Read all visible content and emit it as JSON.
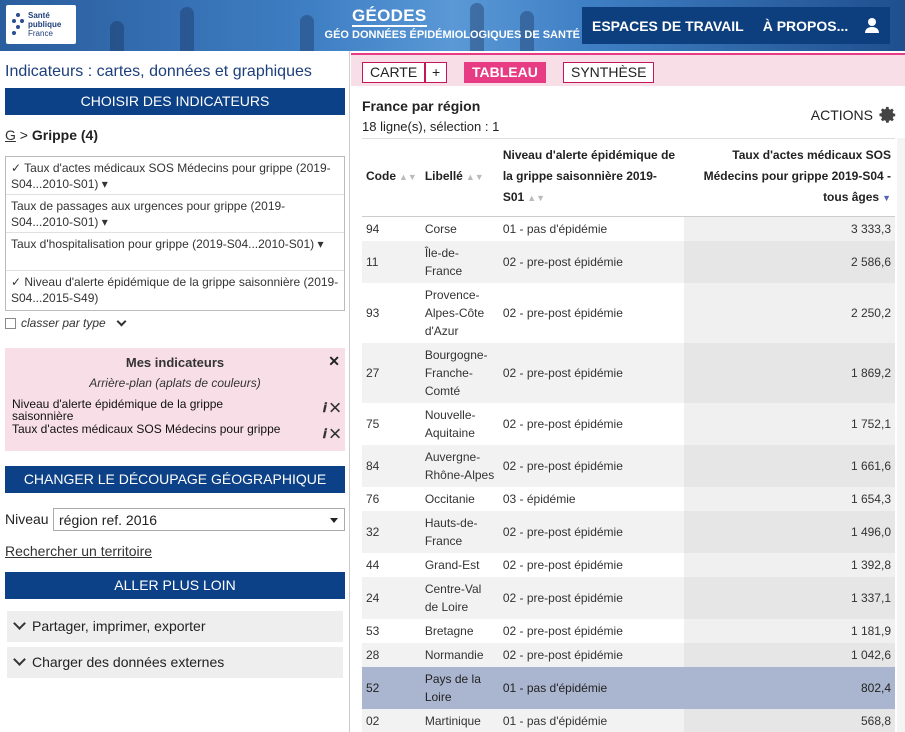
{
  "header": {
    "logo_line1": "Santé",
    "logo_line2": "publique",
    "logo_line3": "France",
    "title": "GÉODES",
    "subtitle": "GÉO DONNÉES ÉPIDÉMIOLOGIQUES DE SANTÉ",
    "nav_workspaces": "ESPACES DE TRAVAIL",
    "nav_about": "À PROPOS...",
    "user_icon": "user-icon"
  },
  "sidebar": {
    "title": "Indicateurs : cartes, données et graphiques",
    "choose_btn": "CHOISIR DES INDICATEURS",
    "crumb_root": "G",
    "crumb_sep": " > ",
    "crumb_current": "Grippe (4)",
    "indicators": [
      "✓ Taux d'actes médicaux SOS Médecins pour grippe (2019-S04...2010-S01) ▾",
      "Taux de passages aux urgences pour grippe (2019-S04...2010-S01) ▾",
      "Taux d'hospitalisation pour grippe (2019-S04...2010-S01) ▾",
      "✓ Niveau d'alerte épidémique de la grippe saisonnière (2019-S04...2015-S49)"
    ],
    "classer": "classer par type",
    "mine_title": "Mes indicateurs",
    "mine_background": "Arrière-plan (aplats de couleurs)",
    "mine_items": [
      "Niveau d'alerte épidémique de la grippe saisonnière",
      "Taux d'actes médicaux SOS Médecins pour grippe"
    ],
    "change_btn": "CHANGER LE DÉCOUPAGE GÉOGRAPHIQUE",
    "niveau_label": "Niveau",
    "niveau_value": "région ref. 2016",
    "search_link": "Rechercher un territoire",
    "further_btn": "ALLER PLUS LOIN",
    "acc_share": "Partager, imprimer, exporter",
    "acc_external": "Charger des données externes"
  },
  "tabs": {
    "carte": "CARTE",
    "plus": "+",
    "tableau": "TABLEAU",
    "synthese": "SYNTHÈSE"
  },
  "table": {
    "title": "France par région",
    "count": "18 ligne(s), sélection : 1",
    "actions": "ACTIONS",
    "headers": [
      "Code",
      "Libellé",
      "Niveau d'alerte épidémique de la grippe saisonnière 2019-S01",
      "Taux d'actes médicaux SOS Médecins pour grippe 2019-S04 - tous âges"
    ],
    "rows": [
      {
        "code": "94",
        "label": "Corse",
        "level": "01 - pas d'épidémie",
        "value": "3 333,3"
      },
      {
        "code": "11",
        "label": "Île-de-France",
        "level": "02 - pre-post épidémie",
        "value": "2 586,6"
      },
      {
        "code": "93",
        "label": "Provence-Alpes-Côte d'Azur",
        "level": "02 - pre-post épidémie",
        "value": "2 250,2"
      },
      {
        "code": "27",
        "label": "Bourgogne-Franche-Comté",
        "level": "02 - pre-post épidémie",
        "value": "1 869,2"
      },
      {
        "code": "75",
        "label": "Nouvelle-Aquitaine",
        "level": "02 - pre-post épidémie",
        "value": "1 752,1"
      },
      {
        "code": "84",
        "label": "Auvergne-Rhône-Alpes",
        "level": "02 - pre-post épidémie",
        "value": "1 661,6"
      },
      {
        "code": "76",
        "label": "Occitanie",
        "level": "03 - épidémie",
        "value": "1 654,3"
      },
      {
        "code": "32",
        "label": "Hauts-de-France",
        "level": "02 - pre-post épidémie",
        "value": "1 496,0"
      },
      {
        "code": "44",
        "label": "Grand-Est",
        "level": "02 - pre-post épidémie",
        "value": "1 392,8"
      },
      {
        "code": "24",
        "label": "Centre-Val de Loire",
        "level": "02 - pre-post épidémie",
        "value": "1 337,1"
      },
      {
        "code": "53",
        "label": "Bretagne",
        "level": "02 - pre-post épidémie",
        "value": "1 181,9"
      },
      {
        "code": "28",
        "label": "Normandie",
        "level": "02 - pre-post épidémie",
        "value": "1 042,6"
      },
      {
        "code": "52",
        "label": "Pays de la Loire",
        "level": "01 - pas d'épidémie",
        "value": "802,4",
        "selected": true
      },
      {
        "code": "02",
        "label": "Martinique",
        "level": "01 - pas d'épidémie",
        "value": "568,8"
      }
    ]
  }
}
